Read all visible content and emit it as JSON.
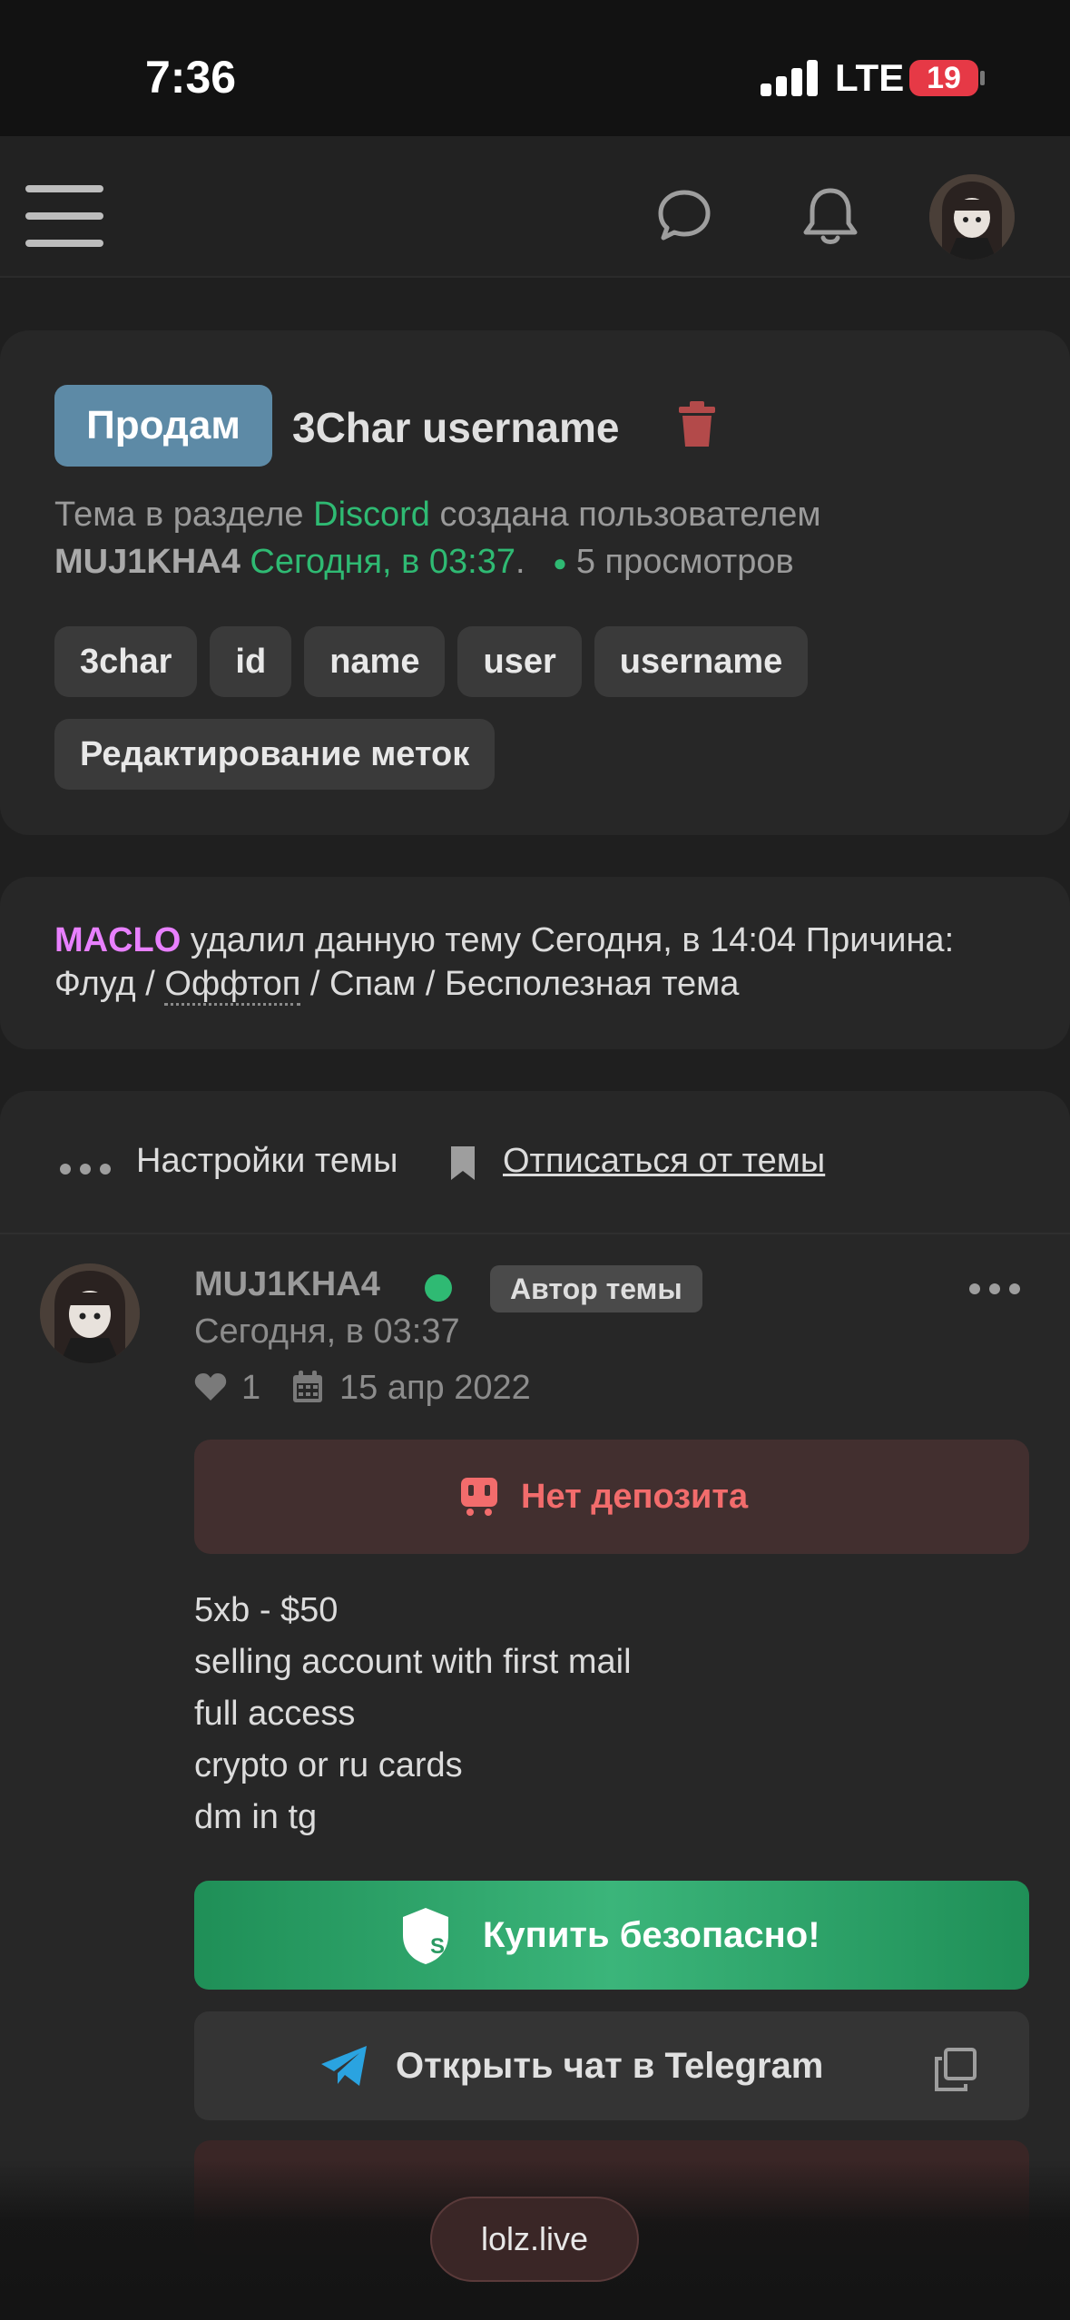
{
  "status_bar": {
    "time": "7:36",
    "network": "LTE",
    "battery": "19"
  },
  "topic": {
    "prefix": "Продам",
    "title": "3Char username",
    "meta_prefix": "Тема в разделе",
    "section": "Discord",
    "meta_mid": "создана пользователем",
    "author": "MUJ1KHA4",
    "created": "Сегодня, в 03:37",
    "created_suffix": ".",
    "views": "5 просмотров",
    "tags": [
      "3char",
      "id",
      "name",
      "user",
      "username"
    ],
    "edit_tags": "Редактирование меток"
  },
  "notice": {
    "moderator": "MACLO",
    "text_before": "удалил данную тему Сегодня, в 14:04 Причина: Флуд / ",
    "offtop": "Оффтоп",
    "text_after": " / Спам / Бесполезная тема"
  },
  "settings": {
    "label": "Настройки темы",
    "unsubscribe": "Отписаться от темы"
  },
  "post": {
    "author": "MUJ1KHA4",
    "badge": "Автор темы",
    "date": "Сегодня, в 03:37",
    "likes": "1",
    "registered": "15 апр 2022",
    "deposit": "Нет депозита",
    "body": [
      "5xb - $50",
      "selling account with first mail",
      "full access",
      "crypto or ru cards",
      "dm in tg"
    ],
    "buy_button": "Купить безопасно!",
    "telegram_button": "Открыть чат в Telegram"
  },
  "browser": {
    "url": "lolz.live"
  },
  "colors": {
    "accent_green": "#2fba73",
    "prefix_blue": "#5d8aa6",
    "moderator_pink": "#e880ff",
    "deposit_red": "#f26c6c"
  },
  "icons": [
    "menu-icon",
    "chat-icon",
    "bell-icon",
    "trash-icon",
    "dots-icon",
    "bookmark-icon",
    "heart-icon",
    "calendar-icon",
    "deposit-icon",
    "shield-icon",
    "telegram-icon",
    "copy-icon"
  ]
}
